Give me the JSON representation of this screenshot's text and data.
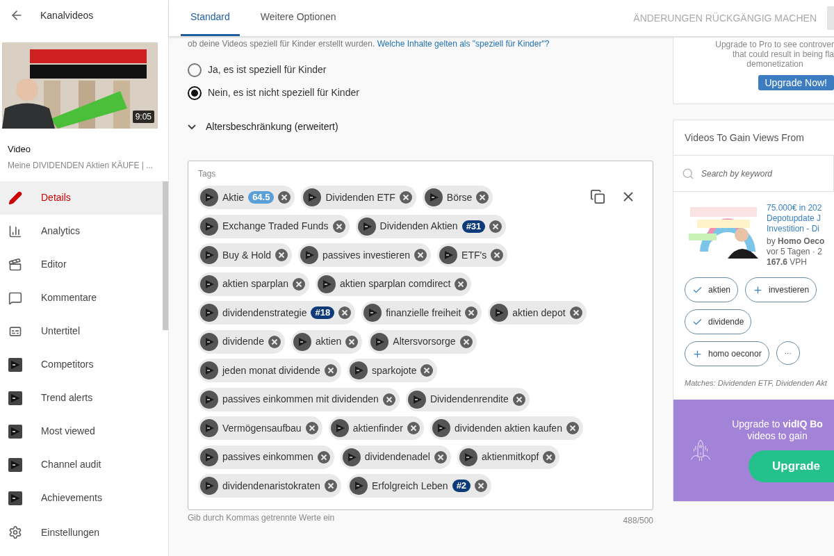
{
  "sidebar": {
    "back_title": "Kanalvideos",
    "video": {
      "duration": "9:05",
      "label": "Video",
      "title": "Meine DIVIDENDEN Aktien KÄUFE | ..."
    },
    "items": [
      {
        "label": "Details",
        "kind": "pencil",
        "selected": true
      },
      {
        "label": "Analytics",
        "kind": "chart",
        "selected": false
      },
      {
        "label": "Editor",
        "kind": "film",
        "selected": false
      },
      {
        "label": "Kommentare",
        "kind": "comment",
        "selected": false
      },
      {
        "label": "Untertitel",
        "kind": "subtitles",
        "selected": false
      },
      {
        "label": "Competitors",
        "kind": "vidiq",
        "selected": false
      },
      {
        "label": "Trend alerts",
        "kind": "vidiq",
        "selected": false
      },
      {
        "label": "Most viewed",
        "kind": "vidiq",
        "selected": false
      },
      {
        "label": "Channel audit",
        "kind": "vidiq",
        "selected": false
      },
      {
        "label": "Achievements",
        "kind": "vidiq",
        "selected": false
      }
    ],
    "settings": "Einstellungen"
  },
  "tabs": [
    {
      "label": "Standard",
      "selected": true
    },
    {
      "label": "Weitere Optionen",
      "selected": false
    }
  ],
  "undo_button": "ÄNDERUNGEN RÜCKGÄNGIG MACHEN",
  "audience": {
    "intro": "ob deine Videos speziell für Kinder erstellt wurden.",
    "link": "Welche Inhalte gelten als \"speziell für Kinder\"?",
    "options": [
      {
        "label": "Ja, es ist speziell für Kinder",
        "selected": false
      },
      {
        "label": "Nein, es ist nicht speziell für Kinder",
        "selected": true
      }
    ],
    "age_restriction": {
      "label": "Altersbeschränkung (erweitert)",
      "expanded": false
    }
  },
  "tags": {
    "label": "Tags",
    "helper": "Gib durch Kommas getrennte Werte ein",
    "counter": "488/500",
    "rows": [
      {
        "tags": [
          {
            "text": "Aktie",
            "badge": {
              "text": "64.5",
              "color": "#5a9fd8"
            }
          },
          {
            "text": "Dividenden ETF"
          },
          {
            "text": "Börse"
          }
        ]
      },
      {
        "tags": [
          {
            "text": "Exchange Traded Funds"
          },
          {
            "text": "Dividenden Aktien",
            "badge": {
              "text": "#31",
              "color": "#0d3b7a"
            }
          }
        ]
      },
      {
        "tags": [
          {
            "text": "Buy & Hold"
          },
          {
            "text": "passives investieren"
          },
          {
            "text": "ETF's"
          }
        ]
      },
      {
        "tags": [
          {
            "text": "aktien sparplan"
          },
          {
            "text": "aktien sparplan comdirect"
          }
        ]
      },
      {
        "tags": [
          {
            "text": "dividendenstrategie",
            "badge": {
              "text": "#18",
              "color": "#0d3b7a"
            }
          },
          {
            "text": "finanzielle freiheit"
          },
          {
            "text": "aktien depot"
          }
        ]
      },
      {
        "tags": [
          {
            "text": "dividende"
          },
          {
            "text": "aktien"
          },
          {
            "text": "Altersvorsorge"
          }
        ]
      },
      {
        "tags": [
          {
            "text": "jeden monat dividende"
          },
          {
            "text": "sparkojote"
          }
        ]
      },
      {
        "tags": [
          {
            "text": "passives einkommen mit dividenden"
          },
          {
            "text": "Dividendenrendite"
          }
        ]
      },
      {
        "tags": [
          {
            "text": "Vermögensaufbau"
          },
          {
            "text": "aktienfinder"
          },
          {
            "text": "dividenden aktien kaufen"
          }
        ]
      },
      {
        "tags": [
          {
            "text": "passives einkommen"
          },
          {
            "text": "dividendenadel"
          },
          {
            "text": "aktienmitkopf"
          }
        ]
      },
      {
        "tags": [
          {
            "text": "dividendenaristokraten"
          },
          {
            "text": "Erfolgreich Leben",
            "badge": {
              "text": "#2",
              "color": "#0d3b7a"
            }
          }
        ]
      }
    ]
  },
  "pro_card": {
    "lines": [
      "Upgrade to Pro to see controver",
      "that could result in being fla",
      "demonetization"
    ],
    "button": "Upgrade Now!"
  },
  "gain_views": {
    "title": "Videos To Gain Views From",
    "search_placeholder": "Search by keyword",
    "video": {
      "title_lines": [
        "75.000€ in 202",
        "Depotupdate J",
        "Investition - Di"
      ],
      "channel": "by **Homo Oeco**",
      "age": "vor 5 Tagen · 2",
      "vph": "**167.6** VPH"
    },
    "chips": [
      {
        "text": "aktien",
        "added": true
      },
      {
        "text": "investieren",
        "added": false
      },
      {
        "text": "dividende",
        "added": true
      },
      {
        "text": "homo oeconor",
        "added": false
      }
    ],
    "more": "···",
    "matches": "Matches: Dividenden ETF, Dividenden Akt"
  },
  "boost": {
    "text": "Upgrade to **vidIQ Bo**",
    "text2": "videos to gain",
    "button": "Upgrade"
  }
}
